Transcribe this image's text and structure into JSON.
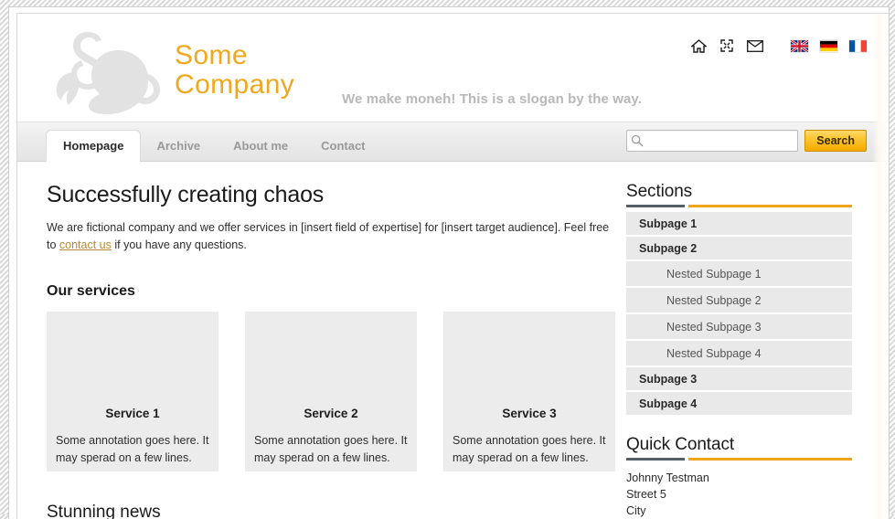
{
  "header": {
    "brand": "Some\nCompany",
    "slogan": "We make moneh! This is a slogan by the way.",
    "logo_name": "abstract-swirl-logo"
  },
  "topbar": {
    "icons": [
      {
        "name": "home-icon",
        "title": "Home"
      },
      {
        "name": "expand-icon",
        "title": "Fullscreen"
      },
      {
        "name": "mail-icon",
        "title": "Mail"
      }
    ],
    "flags": [
      {
        "name": "flag-uk",
        "title": "English"
      },
      {
        "name": "flag-germany",
        "title": "Deutsch"
      },
      {
        "name": "flag-france",
        "title": "Français"
      }
    ]
  },
  "nav": {
    "tabs": [
      {
        "label": "Homepage",
        "active": true
      },
      {
        "label": "Archive",
        "active": false
      },
      {
        "label": "About me",
        "active": false
      },
      {
        "label": "Contact",
        "active": false
      }
    ]
  },
  "search": {
    "value": "",
    "placeholder": "",
    "button_label": "Search",
    "icon": "magnifier-icon"
  },
  "main": {
    "title": "Successfully creating chaos",
    "intro_before_link": "We are fictional company and we offer services in [insert field of expertise] for [insert target audience]. Feel free to ",
    "intro_link": "contact us",
    "intro_after_link": " if you have any questions.",
    "services_heading": "Our services",
    "services": [
      {
        "title": "Service 1",
        "text": "Some annotation goes here. It may sperad on a few lines."
      },
      {
        "title": "Service 2",
        "text": "Some annotation goes here. It may sperad on a few lines."
      },
      {
        "title": "Service 3",
        "text": "Some annotation goes here. It may sperad on a few lines."
      }
    ],
    "news_heading": "Stunning news"
  },
  "sidebar": {
    "sections_title": "Sections",
    "sections_items": [
      {
        "label": "Subpage 1",
        "nested": false
      },
      {
        "label": "Subpage 2",
        "nested": false
      },
      {
        "label": "Nested Subpage 1",
        "nested": true
      },
      {
        "label": "Nested Subpage 2",
        "nested": true
      },
      {
        "label": "Nested Subpage 3",
        "nested": true
      },
      {
        "label": "Nested Subpage 4",
        "nested": true
      },
      {
        "label": "Subpage 3",
        "nested": false
      },
      {
        "label": "Subpage 4",
        "nested": false
      }
    ],
    "quick_contact_title": "Quick Contact",
    "contact_lines": [
      "Johnny Testman",
      "Street 5",
      "City"
    ]
  },
  "colors": {
    "brand_orange": "#f0a81e",
    "rule_dark": "#555f66",
    "rule_orange": "#efa61c",
    "link": "#b5893b",
    "panel_gray": "#e9e9e9"
  }
}
